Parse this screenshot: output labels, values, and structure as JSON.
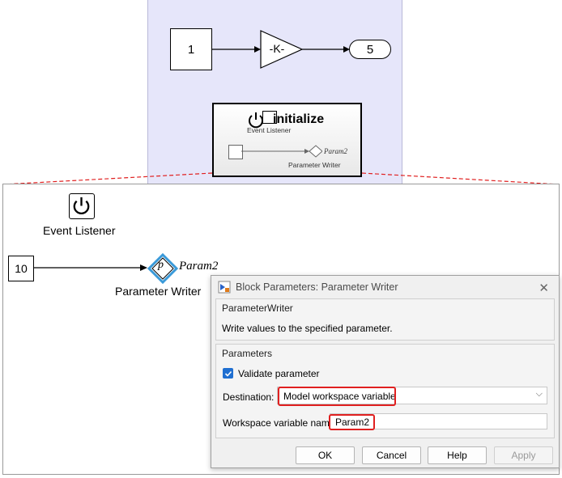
{
  "top_model": {
    "constant_value": "1",
    "gain_label": "-K-",
    "outport_number": "5",
    "subsystem": {
      "title": "initialize",
      "event_listener_label": "Event Listener",
      "param_name": "Param2",
      "parameter_writer_label": "Parameter Writer"
    }
  },
  "zoomed_model": {
    "event_listener_label": "Event Listener",
    "constant_value": "10",
    "param_symbol": "p",
    "param_name": "Param2",
    "parameter_writer_label": "Parameter Writer"
  },
  "dialog": {
    "title": "Block Parameters: Parameter Writer",
    "block_type": "ParameterWriter",
    "description": "Write values to the specified parameter.",
    "parameters_group": "Parameters",
    "validate_label": "Validate parameter",
    "validate_checked": true,
    "destination_label": "Destination:",
    "destination_value": "Model workspace variable",
    "workspace_var_label": "Workspace variable name:",
    "workspace_var_value": "Param2",
    "buttons": {
      "ok": "OK",
      "cancel": "Cancel",
      "help": "Help",
      "apply": "Apply"
    }
  },
  "colors": {
    "canvas_bg": "#e6e6fa",
    "highlight": "#e02020",
    "checkbox": "#1f6fd1",
    "writer_diamond": "#3a9ad9"
  }
}
